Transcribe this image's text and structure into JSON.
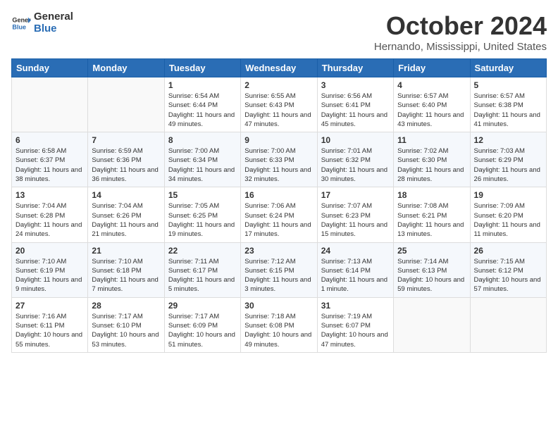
{
  "logo": {
    "text_general": "General",
    "text_blue": "Blue"
  },
  "header": {
    "month": "October 2024",
    "location": "Hernando, Mississippi, United States"
  },
  "weekdays": [
    "Sunday",
    "Monday",
    "Tuesday",
    "Wednesday",
    "Thursday",
    "Friday",
    "Saturday"
  ],
  "weeks": [
    [
      {
        "day": "",
        "info": ""
      },
      {
        "day": "",
        "info": ""
      },
      {
        "day": "1",
        "info": "Sunrise: 6:54 AM\nSunset: 6:44 PM\nDaylight: 11 hours and 49 minutes."
      },
      {
        "day": "2",
        "info": "Sunrise: 6:55 AM\nSunset: 6:43 PM\nDaylight: 11 hours and 47 minutes."
      },
      {
        "day": "3",
        "info": "Sunrise: 6:56 AM\nSunset: 6:41 PM\nDaylight: 11 hours and 45 minutes."
      },
      {
        "day": "4",
        "info": "Sunrise: 6:57 AM\nSunset: 6:40 PM\nDaylight: 11 hours and 43 minutes."
      },
      {
        "day": "5",
        "info": "Sunrise: 6:57 AM\nSunset: 6:38 PM\nDaylight: 11 hours and 41 minutes."
      }
    ],
    [
      {
        "day": "6",
        "info": "Sunrise: 6:58 AM\nSunset: 6:37 PM\nDaylight: 11 hours and 38 minutes."
      },
      {
        "day": "7",
        "info": "Sunrise: 6:59 AM\nSunset: 6:36 PM\nDaylight: 11 hours and 36 minutes."
      },
      {
        "day": "8",
        "info": "Sunrise: 7:00 AM\nSunset: 6:34 PM\nDaylight: 11 hours and 34 minutes."
      },
      {
        "day": "9",
        "info": "Sunrise: 7:00 AM\nSunset: 6:33 PM\nDaylight: 11 hours and 32 minutes."
      },
      {
        "day": "10",
        "info": "Sunrise: 7:01 AM\nSunset: 6:32 PM\nDaylight: 11 hours and 30 minutes."
      },
      {
        "day": "11",
        "info": "Sunrise: 7:02 AM\nSunset: 6:30 PM\nDaylight: 11 hours and 28 minutes."
      },
      {
        "day": "12",
        "info": "Sunrise: 7:03 AM\nSunset: 6:29 PM\nDaylight: 11 hours and 26 minutes."
      }
    ],
    [
      {
        "day": "13",
        "info": "Sunrise: 7:04 AM\nSunset: 6:28 PM\nDaylight: 11 hours and 24 minutes."
      },
      {
        "day": "14",
        "info": "Sunrise: 7:04 AM\nSunset: 6:26 PM\nDaylight: 11 hours and 21 minutes."
      },
      {
        "day": "15",
        "info": "Sunrise: 7:05 AM\nSunset: 6:25 PM\nDaylight: 11 hours and 19 minutes."
      },
      {
        "day": "16",
        "info": "Sunrise: 7:06 AM\nSunset: 6:24 PM\nDaylight: 11 hours and 17 minutes."
      },
      {
        "day": "17",
        "info": "Sunrise: 7:07 AM\nSunset: 6:23 PM\nDaylight: 11 hours and 15 minutes."
      },
      {
        "day": "18",
        "info": "Sunrise: 7:08 AM\nSunset: 6:21 PM\nDaylight: 11 hours and 13 minutes."
      },
      {
        "day": "19",
        "info": "Sunrise: 7:09 AM\nSunset: 6:20 PM\nDaylight: 11 hours and 11 minutes."
      }
    ],
    [
      {
        "day": "20",
        "info": "Sunrise: 7:10 AM\nSunset: 6:19 PM\nDaylight: 11 hours and 9 minutes."
      },
      {
        "day": "21",
        "info": "Sunrise: 7:10 AM\nSunset: 6:18 PM\nDaylight: 11 hours and 7 minutes."
      },
      {
        "day": "22",
        "info": "Sunrise: 7:11 AM\nSunset: 6:17 PM\nDaylight: 11 hours and 5 minutes."
      },
      {
        "day": "23",
        "info": "Sunrise: 7:12 AM\nSunset: 6:15 PM\nDaylight: 11 hours and 3 minutes."
      },
      {
        "day": "24",
        "info": "Sunrise: 7:13 AM\nSunset: 6:14 PM\nDaylight: 11 hours and 1 minute."
      },
      {
        "day": "25",
        "info": "Sunrise: 7:14 AM\nSunset: 6:13 PM\nDaylight: 10 hours and 59 minutes."
      },
      {
        "day": "26",
        "info": "Sunrise: 7:15 AM\nSunset: 6:12 PM\nDaylight: 10 hours and 57 minutes."
      }
    ],
    [
      {
        "day": "27",
        "info": "Sunrise: 7:16 AM\nSunset: 6:11 PM\nDaylight: 10 hours and 55 minutes."
      },
      {
        "day": "28",
        "info": "Sunrise: 7:17 AM\nSunset: 6:10 PM\nDaylight: 10 hours and 53 minutes."
      },
      {
        "day": "29",
        "info": "Sunrise: 7:17 AM\nSunset: 6:09 PM\nDaylight: 10 hours and 51 minutes."
      },
      {
        "day": "30",
        "info": "Sunrise: 7:18 AM\nSunset: 6:08 PM\nDaylight: 10 hours and 49 minutes."
      },
      {
        "day": "31",
        "info": "Sunrise: 7:19 AM\nSunset: 6:07 PM\nDaylight: 10 hours and 47 minutes."
      },
      {
        "day": "",
        "info": ""
      },
      {
        "day": "",
        "info": ""
      }
    ]
  ]
}
